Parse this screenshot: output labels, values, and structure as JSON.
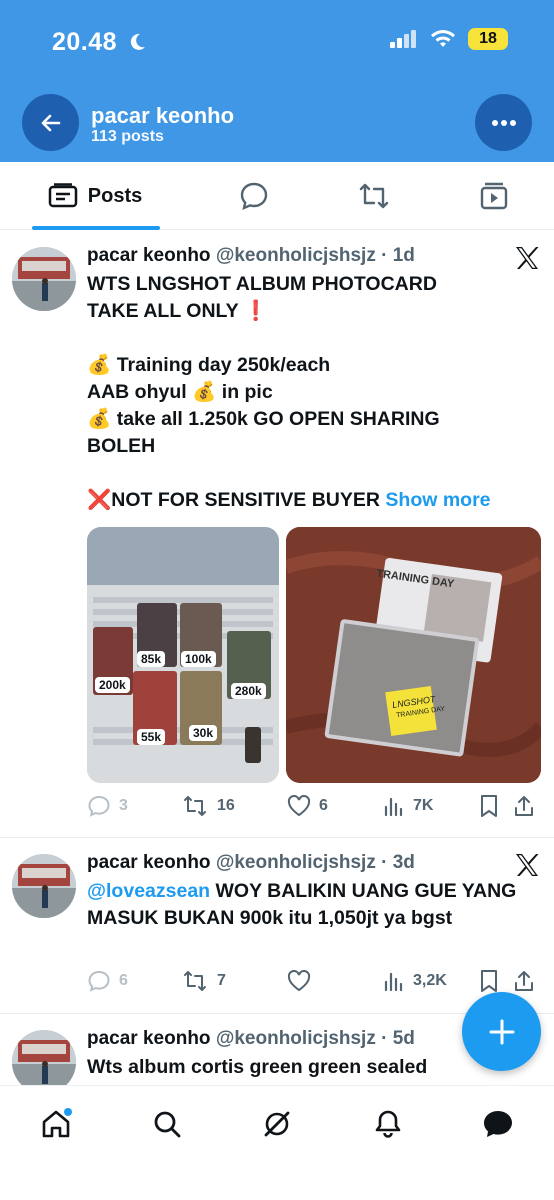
{
  "status_bar": {
    "time": "20.48",
    "battery": "18"
  },
  "header": {
    "title": "pacar keonho",
    "subtitle": "113 posts"
  },
  "tabs": [
    {
      "label": "Posts",
      "icon": "posts-list-icon",
      "active": true
    },
    {
      "label": "",
      "icon": "replies-icon"
    },
    {
      "label": "",
      "icon": "reposts-icon"
    },
    {
      "label": "",
      "icon": "media-icon"
    }
  ],
  "posts": [
    {
      "name": "pacar keonho",
      "handle": "@keonholicjshsjz",
      "time": "· 1d",
      "lines": [
        "WTS LNGSHOT ALBUM PHOTOCARD",
        "TAKE ALL ONLY ❗",
        "",
        "💰 Training day 250k/each",
        "AAB ohyul 💰 in pic",
        "💰  take all 1.250k GO OPEN SHARING",
        "BOLEH",
        "",
        "❌NOT FOR SENSITIVE BUYER"
      ],
      "show_more": "Show more",
      "media_left_labels": [
        "85k",
        "100k",
        "200k",
        "280k",
        "55k",
        "30k"
      ],
      "media_right_text": {
        "album1": "TRAINING DAY",
        "album2": "LNGSHOT",
        "sticker": "TRAINING DAY"
      },
      "actions": {
        "replies": "3",
        "reposts": "16",
        "likes": "6",
        "views": "7K"
      }
    },
    {
      "name": "pacar keonho",
      "handle": "@keonholicjshsjz",
      "time": "· 3d",
      "mention": "@loveazsean",
      "text_after_mention": " WOY BALIKIN UANG GUE YANG MASUK BUKAN 900k itu 1,050jt ya bgst",
      "actions": {
        "replies": "6",
        "reposts": "7",
        "likes": "",
        "views": "3,2K"
      }
    },
    {
      "name": "pacar keonho",
      "handle": "@keonholicjshsjz",
      "time": "· 5d",
      "text": "Wts album cortis green green sealed"
    }
  ],
  "colors": {
    "header_bg": "#3f97e6",
    "accent": "#1d9bf0",
    "text": "#0f1419",
    "muted": "#536471"
  }
}
